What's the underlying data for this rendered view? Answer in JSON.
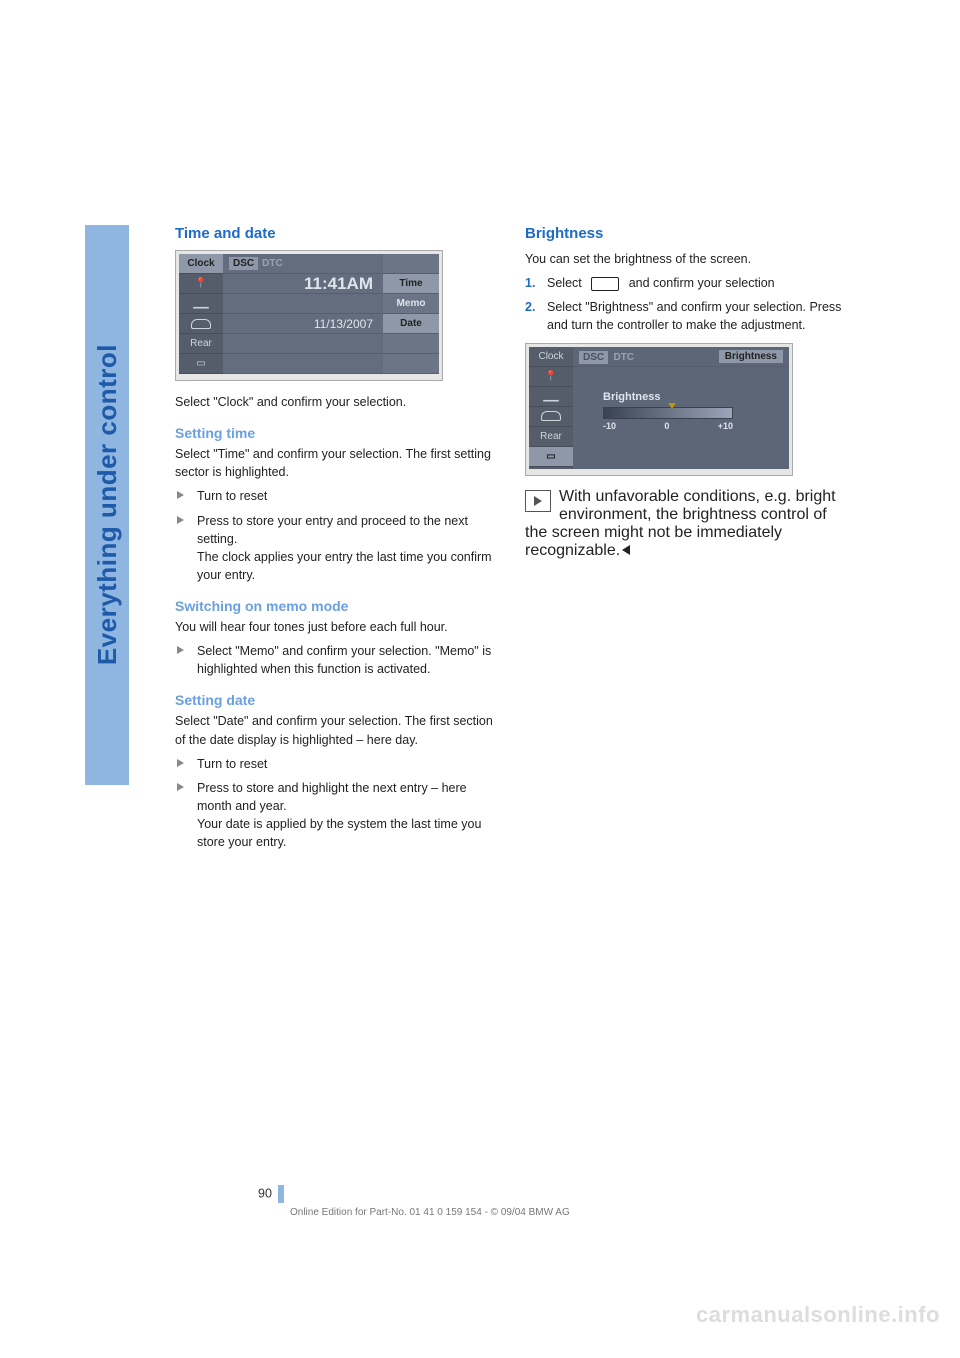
{
  "sidebar": {
    "label": "Everything under control"
  },
  "left": {
    "h_time_date": "Time and date",
    "screenshot1": {
      "tabs_left": [
        "Clock",
        "",
        "",
        "",
        "Rear",
        ""
      ],
      "tabs_top": [
        "DSC",
        "DTC"
      ],
      "time_val": "11:41AM",
      "date_val": "11/13/2007",
      "right_tabs": [
        "Time",
        "Memo",
        "Date"
      ],
      "img_code": ""
    },
    "p_select_clock": "Select \"Clock\" and confirm your selection.",
    "h_setting_time": "Setting time",
    "p_setting_time": "Select \"Time\" and confirm your selection. The first setting sector is highlighted.",
    "li_turn_reset1": "Turn to reset",
    "li_press_store_time": "Press to store your entry and proceed to the next setting.\nThe clock applies your entry the last time you confirm your entry.",
    "h_memo": "Switching on memo mode",
    "p_memo": "You will hear four tones just before each full hour.",
    "li_memo": "Select \"Memo\" and confirm your selection. \"Memo\" is highlighted when this function is activated.",
    "h_setting_date": "Setting date",
    "p_setting_date": "Select \"Date\" and confirm your selection. The first section of the date display is highlighted – here day.",
    "li_turn_reset2": "Turn to reset",
    "li_press_store_date": "Press to store and highlight the next entry – here month and year.\nYour date is applied by the system the last time you store your entry."
  },
  "right": {
    "h_brightness": "Brightness",
    "p_intro": "You can set the brightness of the screen.",
    "ol_1a": "Select",
    "ol_1b": "and confirm your selection",
    "ol_2": "Select \"Brightness\" and confirm your selection. Press and turn the controller to make the adjustment.",
    "screenshot2": {
      "tabs_left": [
        "Clock",
        "",
        "",
        "",
        "Rear",
        ""
      ],
      "tabs_top": [
        "DSC",
        "DTC"
      ],
      "right_tab": "Brightness",
      "panel_title": "Brightness",
      "scale_min": "-10",
      "scale_mid": "0",
      "scale_max": "+10",
      "img_code": ""
    },
    "note": "With unfavorable conditions, e.g. bright environment, the brightness control of the screen might not be immediately recognizable."
  },
  "page_number": "90",
  "footer": "Online Edition for Part-No. 01 41 0 159 154 - © 09/04 BMW AG",
  "watermark": "carmanualsonline.info"
}
